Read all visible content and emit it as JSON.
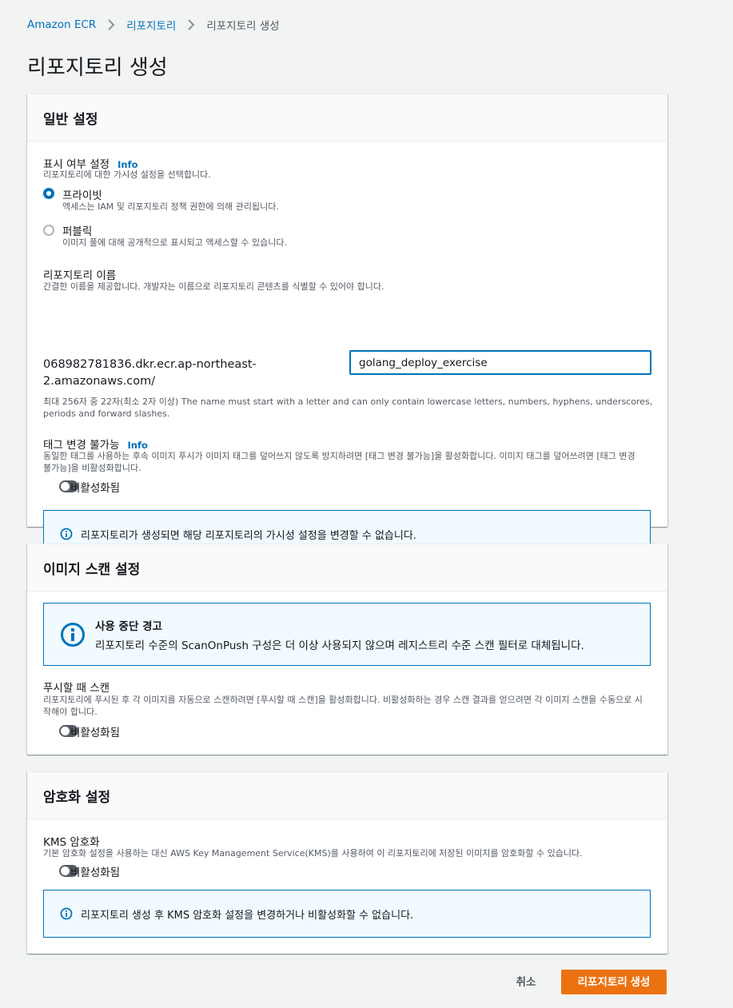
{
  "breadcrumb": {
    "items": [
      "Amazon ECR",
      "리포지토리",
      "리포지토리 생성"
    ]
  },
  "page_title": "리포지토리 생성",
  "general": {
    "title": "일반 설정",
    "visibility_label": "표시 여부 설정",
    "info_link": "Info",
    "visibility_desc": "리포지토리에 대한 가시성 설정을 선택합니다.",
    "private_label": "프라이빗",
    "private_desc": "액세스는 IAM 및 리포지토리 정책 권한에 의해 관리됩니다.",
    "private_selected": true,
    "public_label": "퍼블릭",
    "public_desc": "이미지 풀에 대해 공개적으로 표시되고 액세스할 수 있습니다.",
    "repo_name_label": "리포지토리 이름",
    "repo_name_desc": "간결한 이름을 제공합니다. 개발자는 이름으로 리포지토리 콘텐츠를 식별할 수 있어야 합니다.",
    "uri_prefix_line1": "068982781836.dkr.ecr.ap-northeast-",
    "uri_prefix_line2": "2.amazonaws.com/",
    "repo_name_value": "golang_deploy_exercise",
    "repo_name_constraint_line1": "최대 256자 중 22자(최소 2자 이상) The name must start with a letter and can only contain lowercase letters, numbers, hyphens, underscores,",
    "repo_name_constraint_line2": "periods and forward slashes.",
    "tag_immutability_label": "태그 변경 불가능",
    "tag_immutability_desc_line1": "동일한 태그를 사용하는 후속 이미지 푸시가 이미지 태그를 덮어쓰지 않도록 방지하려면 [태그 변경 불가능]을 활성화합니다. 이미지 태그를 덮어쓰려면 [태그 변경",
    "tag_immutability_desc_line2": "불가능]을 비활성화합니다.",
    "tag_immutability_state": "비활성화됨",
    "alert_text": "리포지토리가 생성되면 해당 리포지토리의 가시성 설정을 변경할 수 없습니다."
  },
  "scan": {
    "title": "이미지 스캔 설정",
    "warning_title": "사용 중단 경고",
    "warning_text": "리포지토리 수준의 ScanOnPush 구성은 더 이상 사용되지 않으며 레지스트리 수준 스캔 필터로 대체됩니다.",
    "scan_on_push_label": "푸시할 때 스캔",
    "scan_on_push_desc_line1": "리포지토리에 푸시된 후 각 이미지를 자동으로 스캔하려면 [푸시할 때 스캔]을 활성화합니다. 비활성화하는 경우 스캔 결과를 얻으려면 각 이미지 스캔을 수동으로 시",
    "scan_on_push_desc_line2": "작해야 합니다.",
    "scan_on_push_state": "비활성화됨"
  },
  "encryption": {
    "title": "암호화 설정",
    "kms_label": "KMS 암호화",
    "kms_desc": "기본 암호화 설정을 사용하는 대신 AWS Key Management Service(KMS)를 사용하여 이 리포지토리에 저장된 이미지를 암호화할 수 있습니다.",
    "kms_state": "비활성화됨",
    "alert_text": "리포지토리 생성 후 KMS 암호화 설정을 변경하거나 비활성화할 수 없습니다."
  },
  "footer": {
    "cancel_label": "취소",
    "create_label": "리포지토리 생성"
  },
  "colors": {
    "link": "#0073bb",
    "primary_button": "#ec7211",
    "info_bg": "#f1faff"
  }
}
